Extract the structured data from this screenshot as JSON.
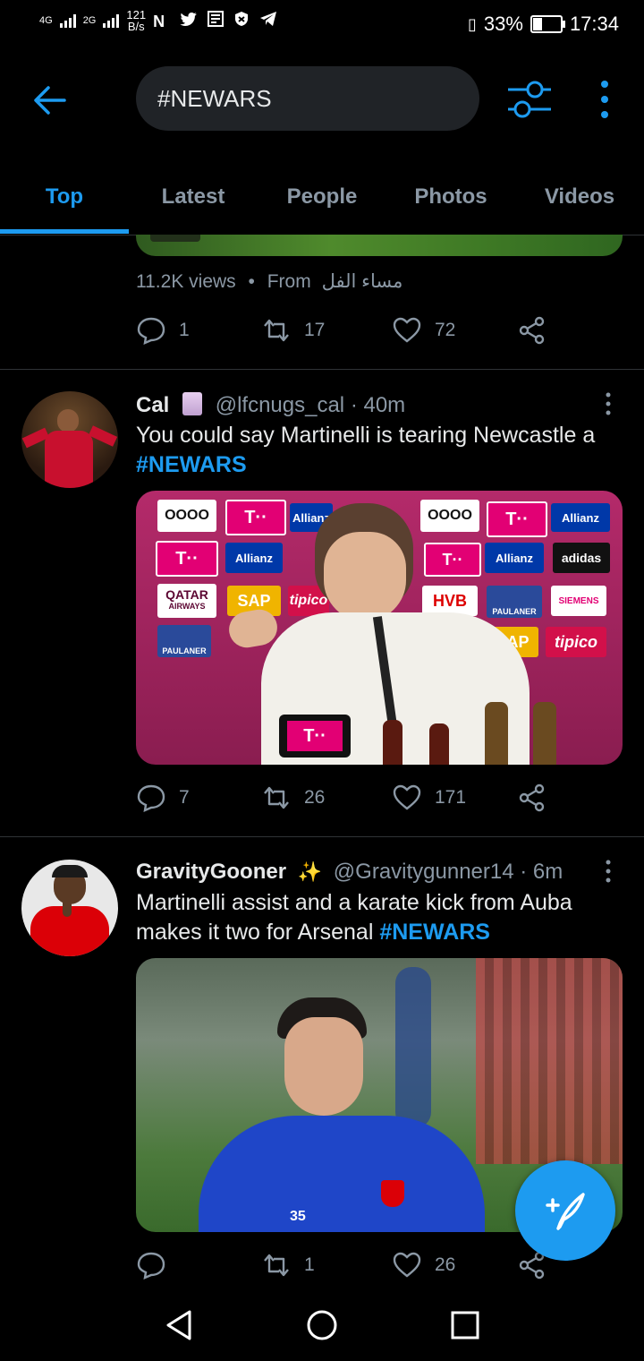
{
  "status_bar": {
    "network_1": "4G",
    "network_2": "2G",
    "speed_value": "121",
    "speed_unit": "B/s",
    "battery_pct_label": "33%",
    "battery_level": 0.33,
    "time": "17:34"
  },
  "search": {
    "query": "#NEWARS"
  },
  "tabs": [
    {
      "label": "Top",
      "active": true
    },
    {
      "label": "Latest"
    },
    {
      "label": "People"
    },
    {
      "label": "Photos"
    },
    {
      "label": "Videos"
    }
  ],
  "tweet0": {
    "views": "11.2K views",
    "dot": "•",
    "from_label": "From",
    "from_source": "مساء الفل",
    "replies": "1",
    "retweets": "17",
    "likes": "72"
  },
  "tweet1": {
    "name": "Cal",
    "handle": "@lfcnugs_cal",
    "time": "· 40m",
    "text": "You could say Martinelli is tearing Newcastle a",
    "hashtag": "#NEWARS",
    "media_labels": {
      "t_logo": "T··",
      "allianz": "Allianz",
      "audi": "OOOO",
      "qatar": "QATAR",
      "airways": "AIRWAYS",
      "sap": "SAP",
      "tipico": "tipico",
      "hvb": "HVB",
      "paulaner": "PAULANER",
      "adidas": "adidas",
      "siemens": "SIEMENS"
    },
    "replies": "7",
    "retweets": "26",
    "likes": "171"
  },
  "tweet2": {
    "name": "GravityGooner",
    "handle": "@Gravitygunner14",
    "time": "· 6m",
    "text": "Martinelli assist and a karate kick from Auba makes it two for Arsenal",
    "hashtag": "#NEWARS",
    "shirt_number": "35",
    "replies": "",
    "retweets": "1",
    "likes": "26"
  },
  "colors": {
    "accent": "#1d9bf0",
    "background": "#000000",
    "secondary_text": "#8b98a5",
    "divider": "#2f3336"
  },
  "icons": [
    "back-arrow-icon",
    "filter-icon",
    "more-vertical-icon",
    "reply-icon",
    "retweet-icon",
    "like-icon",
    "share-icon",
    "compose-tweet-icon",
    "nav-back-icon",
    "nav-home-icon",
    "nav-recents-icon"
  ]
}
